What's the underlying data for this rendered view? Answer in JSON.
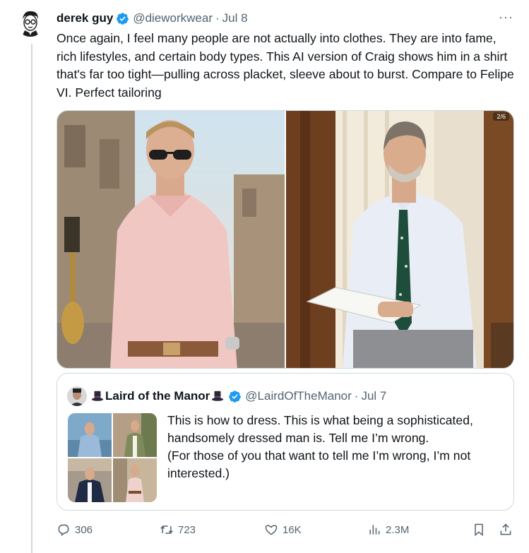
{
  "tweet": {
    "author_name": "derek guy",
    "author_handle": "@dieworkwear",
    "separator": "·",
    "date": "Jul 8",
    "more": "···",
    "text": "Once again, I feel many people are not actually into clothes. They are into fame, rich lifestyles, and certain body types. This AI version of Craig shows him in a shirt that's far too tight—pulling across placket, sleeve about to burst. Compare to Felipe VI. Perfect tailoring",
    "media_badge": "2/6"
  },
  "quote": {
    "author_name": "Laird of the Manor",
    "author_handle": "@LairdOfTheManor",
    "separator": "·",
    "date": "Jul 7",
    "text_line1": "This is how to dress. This is what being a sophisticated, handsomely dressed man is. Tell me I’m wrong.",
    "text_line2": "(For those of you that want to tell me I’m wrong, I’m not interested.)"
  },
  "actions": {
    "replies": "306",
    "reposts": "723",
    "likes": "16K",
    "views": "2.3M"
  },
  "colors": {
    "text_primary": "#0f1419",
    "text_secondary": "#536471",
    "verified_blue": "#1d9bf0",
    "border": "#cfd9de"
  },
  "icons": [
    "verified-badge-icon",
    "more-icon",
    "top-hat-icon",
    "reply-icon",
    "repost-icon",
    "like-icon",
    "views-icon",
    "bookmark-icon",
    "share-icon"
  ]
}
